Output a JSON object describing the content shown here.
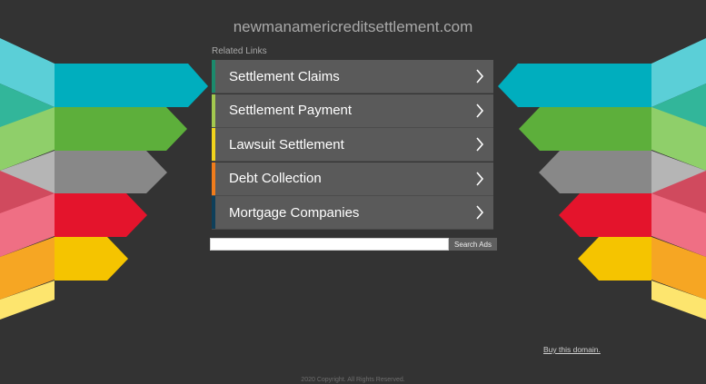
{
  "domain": "newmanamericreditsettlement.com",
  "related_label": "Related Links",
  "links": [
    {
      "label": "Settlement Claims",
      "color": "#1b8a6c"
    },
    {
      "label": "Settlement Payment",
      "color": "#a3c84f"
    },
    {
      "label": "Lawsuit Settlement",
      "color": "#f2d41c"
    },
    {
      "label": "Debt Collection",
      "color": "#f07c1b"
    },
    {
      "label": "Mortgage Companies",
      "color": "#0e3f5a"
    }
  ],
  "search": {
    "placeholder": "",
    "value": "",
    "button": "Search Ads"
  },
  "buy_link": "Buy this domain.",
  "copyright": "2020 Copyright. All Rights Reserved.",
  "colors": {
    "background": "#333333",
    "panel": "#5a5a5a",
    "cyan": "#00aebe",
    "green": "#5daf3b",
    "gray": "#888888",
    "red": "#e4142c",
    "yellow": "#f5c400"
  }
}
